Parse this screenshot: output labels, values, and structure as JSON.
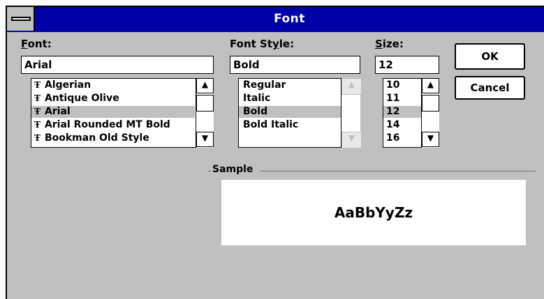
{
  "window": {
    "title": "Font"
  },
  "font": {
    "label": "Font:",
    "value": "Arial",
    "items": [
      {
        "label": "Algerian",
        "selected": false
      },
      {
        "label": "Antique Olive",
        "selected": false
      },
      {
        "label": "Arial",
        "selected": true
      },
      {
        "label": "Arial Rounded MT Bold",
        "selected": false
      },
      {
        "label": "Bookman Old Style",
        "selected": false
      }
    ],
    "icon": "truetype-icon"
  },
  "style": {
    "label": "Font Style:",
    "value": "Bold",
    "items": [
      {
        "label": "Regular",
        "selected": false
      },
      {
        "label": "Italic",
        "selected": false
      },
      {
        "label": "Bold",
        "selected": true
      },
      {
        "label": "Bold Italic",
        "selected": false
      }
    ]
  },
  "size": {
    "label": "Size:",
    "value": "12",
    "items": [
      {
        "label": "10",
        "selected": false
      },
      {
        "label": "11",
        "selected": false
      },
      {
        "label": "12",
        "selected": true
      },
      {
        "label": "14",
        "selected": false
      },
      {
        "label": "16",
        "selected": false
      }
    ]
  },
  "buttons": {
    "ok": "OK",
    "cancel": "Cancel"
  },
  "sample": {
    "label": "Sample",
    "text": "AaBbYyZz"
  }
}
